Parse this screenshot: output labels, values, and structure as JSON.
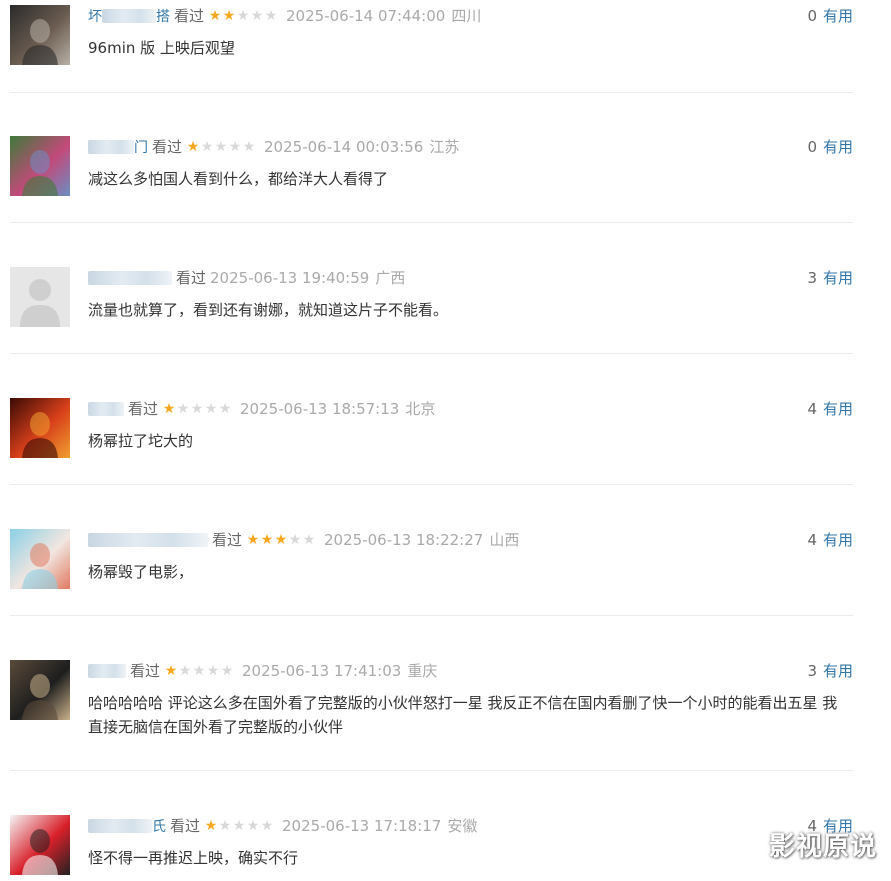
{
  "comments": [
    {
      "user_visible": "坏",
      "user_tail": "搭",
      "watched": "看过",
      "rating": 2,
      "time": "2025-06-14 07:44:00",
      "location": "四川",
      "votes": "0",
      "useful_label": "有用",
      "content": "96min 版 上映后观望",
      "avatar_colors": [
        "#2a2a2a",
        "#6b5c50",
        "#b8b0a6"
      ]
    },
    {
      "user_visible": "",
      "user_tail": "门",
      "watched": "看过",
      "rating": 1,
      "time": "2025-06-14 00:03:56",
      "location": "江苏",
      "votes": "0",
      "useful_label": "有用",
      "content": "减这么多怕国人看到什么，都给洋大人看得了",
      "avatar_colors": [
        "#3f7a3a",
        "#c24a7a",
        "#6b8ec4"
      ]
    },
    {
      "user_visible": "",
      "user_tail": "",
      "watched": "看过",
      "rating": 0,
      "time": "2025-06-13 19:40:59",
      "location": "广西",
      "votes": "3",
      "useful_label": "有用",
      "content": "流量也就算了，看到还有谢娜，就知道这片子不能看。",
      "avatar_colors": [
        "#e6e6e6",
        "#cfcfcf",
        "#e6e6e6"
      ]
    },
    {
      "user_visible": "",
      "user_tail": "",
      "watched": "看过",
      "rating": 1,
      "time": "2025-06-13 18:57:13",
      "location": "北京",
      "votes": "4",
      "useful_label": "有用",
      "content": "杨幂拉了坨大的",
      "avatar_colors": [
        "#3a0a05",
        "#d8401a",
        "#f0a030"
      ]
    },
    {
      "user_visible": "",
      "user_tail": "",
      "watched": "看过",
      "rating": 3,
      "time": "2025-06-13 18:22:27",
      "location": "山西",
      "votes": "4",
      "useful_label": "有用",
      "content": "杨幂毁了电影，",
      "avatar_colors": [
        "#8ad0e6",
        "#f2e6e0",
        "#e07a60"
      ]
    },
    {
      "user_visible": "",
      "user_tail": "",
      "watched": "看过",
      "rating": 1,
      "time": "2025-06-13 17:41:03",
      "location": "重庆",
      "votes": "3",
      "useful_label": "有用",
      "content": "哈哈哈哈哈 评论这么多在国外看了完整版的小伙伴怒打一星 我反正不信在国内看删了快一个小时的能看出五星 我直接无脑信在国外看了完整版的小伙伴",
      "avatar_colors": [
        "#5a4a3a",
        "#1e1e1e",
        "#c9b08a"
      ]
    },
    {
      "user_visible": "",
      "user_tail": "氏",
      "watched": "看过",
      "rating": 1,
      "time": "2025-06-13 17:18:17",
      "location": "安徽",
      "votes": "4",
      "useful_label": "有用",
      "content": "怪不得一再推迟上映，确实不行",
      "avatar_colors": [
        "#f4f4f4",
        "#d8202a",
        "#222222"
      ]
    }
  ],
  "watermark": "影视原说",
  "colors": {
    "link": "#3377aa",
    "star_on": "#f7a820",
    "star_off": "#d9d9d9"
  }
}
